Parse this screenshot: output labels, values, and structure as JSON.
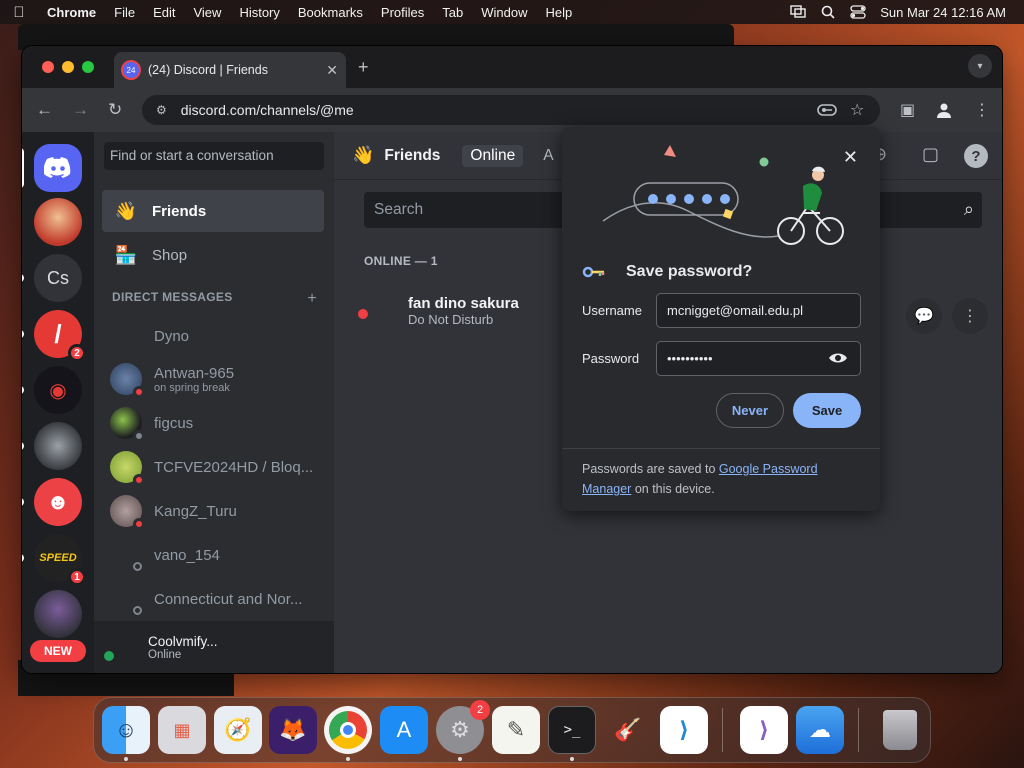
{
  "menubar": {
    "app": "Chrome",
    "items": [
      "File",
      "Edit",
      "View",
      "History",
      "Bookmarks",
      "Profiles",
      "Tab",
      "Window",
      "Help"
    ],
    "datetime": "Sun Mar 24  12:16 AM"
  },
  "browser": {
    "tab_title": "(24) Discord | Friends",
    "tab_badge": "24",
    "url": "discord.com/channels/@me"
  },
  "discord": {
    "search_placeholder": "Find or start a conversation",
    "nav": {
      "friends": "Friends",
      "shop": "Shop"
    },
    "dm_header": "DIRECT MESSAGES",
    "dms": [
      {
        "name": "Dyno",
        "sub": ""
      },
      {
        "name": "Antwan-965",
        "sub": "on spring break"
      },
      {
        "name": "figcus",
        "sub": ""
      },
      {
        "name": "TCFVE2024HD / Bloq...",
        "sub": ""
      },
      {
        "name": "KangZ_Turu",
        "sub": ""
      },
      {
        "name": "vano_154",
        "sub": ""
      },
      {
        "name": "Connecticut and Nor...",
        "sub": ""
      }
    ],
    "user": {
      "name": "Coolvmify...",
      "status": "Online"
    },
    "guilds": {
      "cs_label": "Cs",
      "badge_a": "2",
      "badge_b": "1",
      "new_label": "NEW"
    },
    "topbar": {
      "title": "Friends",
      "tab_online": "Online",
      "tab_partial": "A"
    },
    "main_search_placeholder": "Search",
    "online_header": "ONLINE — 1",
    "friend": {
      "name": "fan dino sakura",
      "status": "Do Not Disturb"
    }
  },
  "save_password": {
    "title": "Save password?",
    "username_label": "Username",
    "username_value": "mcnigget@omail.edu.pl",
    "password_label": "Password",
    "password_value": "••••••••••",
    "never_label": "Never",
    "save_label": "Save",
    "footer_prefix": "Passwords are saved to ",
    "footer_link": "Google Password Manager",
    "footer_suffix": " on this device."
  },
  "dock": {
    "settings_badge": "2"
  },
  "colors": {
    "discord_blurple": "#5865f2",
    "dnd_red": "#f23f43",
    "online_green": "#23a55a",
    "chrome_blue": "#8ab4f8"
  }
}
